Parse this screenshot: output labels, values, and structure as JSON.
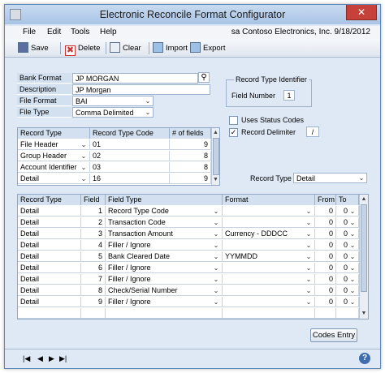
{
  "window": {
    "title": "Electronic Reconcile Format Configurator",
    "close": "✕"
  },
  "menu": {
    "items": [
      "File",
      "Edit",
      "Tools",
      "Help"
    ],
    "company": "sa  Contoso Electronics, Inc.  9/18/2012"
  },
  "toolbar": {
    "save": "Save",
    "delete": "Delete",
    "clear": "Clear",
    "import": "Import",
    "export": "Export"
  },
  "header": {
    "bank_format_label": "Bank Format",
    "bank_format_value": "JP MORGAN",
    "description_label": "Description",
    "description_value": "JP Morgan",
    "file_format_label": "File Format",
    "file_format_value": "BAI",
    "file_type_label": "File Type",
    "file_type_value": "Comma Delimited"
  },
  "record_type_identifier": {
    "title": "Record Type Identifier",
    "field_number_label": "Field Number",
    "field_number_value": "1"
  },
  "options": {
    "uses_status_codes": "Uses Status Codes",
    "uses_status_codes_checked": false,
    "record_delimiter": "Record Delimiter",
    "record_delimiter_checked": true,
    "record_delimiter_value": "/"
  },
  "record_types": {
    "columns": [
      "Record Type",
      "Record Type Code",
      "# of fields"
    ],
    "rows": [
      {
        "type": "File Header",
        "code": "01",
        "fields": "9"
      },
      {
        "type": "Group Header",
        "code": "02",
        "fields": "8"
      },
      {
        "type": "Account Identifier",
        "code": "03",
        "fields": "8"
      },
      {
        "type": "Detail",
        "code": "16",
        "fields": "9"
      }
    ]
  },
  "record_type_filter": {
    "label": "Record Type",
    "value": "Detail"
  },
  "fields_grid": {
    "columns": [
      "Record Type",
      "Field",
      "Field Type",
      "Format",
      "From",
      "To"
    ],
    "rows": [
      {
        "record_type": "Detail",
        "field": "1",
        "field_type": "Record Type Code",
        "format": "",
        "from": "0",
        "to": "0"
      },
      {
        "record_type": "Detail",
        "field": "2",
        "field_type": "Transaction Code",
        "format": "",
        "from": "0",
        "to": "0"
      },
      {
        "record_type": "Detail",
        "field": "3",
        "field_type": "Transaction Amount",
        "format": "Currency - DDDCC",
        "from": "0",
        "to": "0"
      },
      {
        "record_type": "Detail",
        "field": "4",
        "field_type": "Filler / Ignore",
        "format": "",
        "from": "0",
        "to": "0"
      },
      {
        "record_type": "Detail",
        "field": "5",
        "field_type": "Bank Cleared Date",
        "format": "YYMMDD",
        "from": "0",
        "to": "0"
      },
      {
        "record_type": "Detail",
        "field": "6",
        "field_type": "Filler / Ignore",
        "format": "",
        "from": "0",
        "to": "0"
      },
      {
        "record_type": "Detail",
        "field": "7",
        "field_type": "Filler / Ignore",
        "format": "",
        "from": "0",
        "to": "0"
      },
      {
        "record_type": "Detail",
        "field": "8",
        "field_type": "Check/Serial Number",
        "format": "",
        "from": "0",
        "to": "0"
      },
      {
        "record_type": "Detail",
        "field": "9",
        "field_type": "Filler / Ignore",
        "format": "",
        "from": "0",
        "to": "0"
      }
    ]
  },
  "codes_entry": "Codes Entry",
  "nav": [
    "|◀",
    "◀",
    "▶",
    "▶|"
  ],
  "help": "?",
  "colors": {
    "window_bg": "#dfe9f5",
    "label_bg": "#d3e0ef",
    "close_red": "#c6413a"
  },
  "icons": {
    "lookup": "magnifier-icon",
    "dropdown": "chevron-down-icon",
    "help": "help-icon"
  }
}
